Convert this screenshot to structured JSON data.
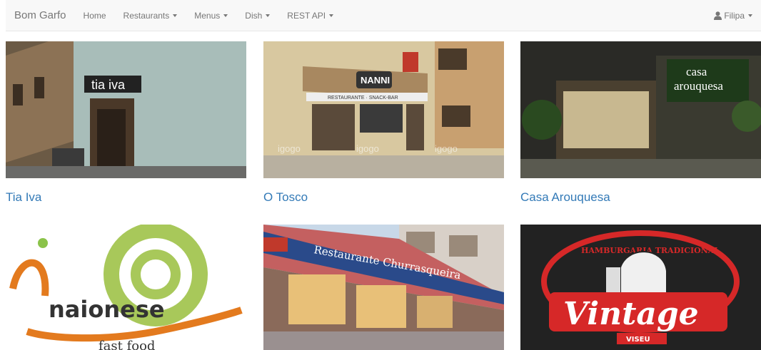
{
  "navbar": {
    "brand": "Bom Garfo",
    "items": [
      {
        "label": "Home",
        "dropdown": false
      },
      {
        "label": "Restaurants",
        "dropdown": true
      },
      {
        "label": "Menus",
        "dropdown": true
      },
      {
        "label": "Dish",
        "dropdown": true
      },
      {
        "label": "REST API",
        "dropdown": true
      }
    ],
    "user": {
      "label": "Filipa",
      "icon": "user-icon"
    }
  },
  "restaurants": [
    {
      "name": "Tia Iva",
      "sign": "tia iva"
    },
    {
      "name": "O Tosco",
      "sign": "NANNI",
      "sign2": "RESTAURANTE · SNACK-BAR",
      "watermark": "igogo"
    },
    {
      "name": "Casa Arouquesa",
      "sign": "casa",
      "sign2": "arouquesa"
    },
    {
      "name": "",
      "logo_text": "naionese",
      "logo_sub": "fast food"
    },
    {
      "name": "",
      "sign": "Restaurante Churrasqueira"
    },
    {
      "name": "",
      "logo_top": "HAMBURGARIA TRADICIONAL",
      "logo_main": "Vintage",
      "logo_city": "VISEU"
    }
  ],
  "colors": {
    "link": "#337ab7",
    "navbar_bg": "#f8f8f8",
    "navbar_text": "#777777"
  }
}
